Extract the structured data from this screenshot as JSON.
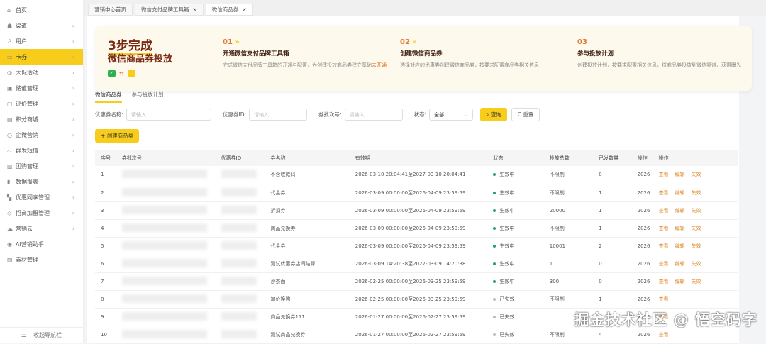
{
  "sidebar": {
    "items": [
      {
        "label": "首页",
        "icon": "⌂",
        "chev": false
      },
      {
        "label": "渠道",
        "icon": "☗",
        "chev": true
      },
      {
        "label": "用户",
        "icon": "♙",
        "chev": true
      },
      {
        "label": "卡券",
        "icon": "▭",
        "chev": true,
        "active": true
      },
      {
        "label": "大促活动",
        "icon": "◎",
        "chev": true
      },
      {
        "label": "储值管理",
        "icon": "▣",
        "chev": true
      },
      {
        "label": "评价管理",
        "icon": "▢",
        "chev": true
      },
      {
        "label": "积分商城",
        "icon": "▤",
        "chev": true
      },
      {
        "label": "企微营销",
        "icon": "○",
        "chev": true
      },
      {
        "label": "群发短信",
        "icon": "▱",
        "chev": true
      },
      {
        "label": "团购管理",
        "icon": "▥",
        "chev": true
      },
      {
        "label": "数据报表",
        "icon": "▮",
        "chev": true
      },
      {
        "label": "优惠同享管理",
        "icon": "▚",
        "chev": true
      },
      {
        "label": "招商加盟管理",
        "icon": "◇",
        "chev": true
      },
      {
        "label": "营销云",
        "icon": "☁",
        "chev": true
      },
      {
        "label": "AI营销助手",
        "icon": "◉",
        "chev": false
      },
      {
        "label": "素材管理",
        "icon": "▨",
        "chev": false
      }
    ],
    "collapse": "收起导航栏"
  },
  "tabs": [
    {
      "label": "营销中心首页",
      "close": false
    },
    {
      "label": "微信支付品牌工具箱",
      "close": true
    },
    {
      "label": "微信商品券",
      "close": true,
      "active": true
    }
  ],
  "banner": {
    "title1": "3步完成",
    "title2": "微信商品券投放",
    "meituan": "美团",
    "steps": [
      {
        "num": "01",
        "title": "开通微信支付品牌工具箱",
        "desc": "完成微信支付品牌工具箱的开通与配置，为创建投放商品券建立基础",
        "link": "去开通"
      },
      {
        "num": "02",
        "title": "创建微信商品券",
        "desc": "选择对应的优惠券创建微信商品券，按要求配置商品券相关信息",
        "link": ""
      },
      {
        "num": "03",
        "title": "参与投放计划",
        "desc": "创建投放计划，按要求配置相关信息，将商品券投放到微信渠道，获得曝光",
        "link": ""
      }
    ]
  },
  "subtabs": [
    "微信商品券",
    "参与投放计划"
  ],
  "filters": {
    "name_label": "优惠券名称:",
    "id_label": "优惠券ID:",
    "batch_label": "券批次号:",
    "placeholder": "请输入",
    "status_label": "状态:",
    "status_value": "全部",
    "search": "查询",
    "reset": "重置"
  },
  "create_button": "创建商品券",
  "table": {
    "headers": [
      "序号",
      "券批次号",
      "优惠券ID",
      "券名称",
      "有效期",
      "状态",
      "投放总数",
      "已发数量",
      "操作",
      "操作"
    ],
    "rows": [
      {
        "no": "1",
        "name": "不含收款码",
        "period": "2026-03-10 20:04:41至2027-03-10 20:04:41",
        "status": "生效中",
        "total": "不限制",
        "sent": "0",
        "op": "2026",
        "active": true
      },
      {
        "no": "2",
        "name": "代金券",
        "period": "2026-03-09 00:00:00至2026-04-09 23:59:59",
        "status": "生效中",
        "total": "不限制",
        "sent": "1",
        "op": "2026",
        "active": true
      },
      {
        "no": "3",
        "name": "折扣券",
        "period": "2026-03-09 00:00:00至2026-04-09 23:59:59",
        "status": "生效中",
        "total": "20000",
        "sent": "1",
        "op": "2026",
        "active": true
      },
      {
        "no": "4",
        "name": "商品兑换券",
        "period": "2026-03-09 00:00:00至2026-04-09 23:59:59",
        "status": "生效中",
        "total": "不限制",
        "sent": "1",
        "op": "2026",
        "active": true
      },
      {
        "no": "5",
        "name": "代金券",
        "period": "2026-03-09 00:00:00至2026-04-09 23:59:59",
        "status": "生效中",
        "total": "10001",
        "sent": "2",
        "op": "2026",
        "active": true
      },
      {
        "no": "6",
        "name": "测试优惠券店间结算",
        "period": "2026-03-09 14:20:38至2027-03-09 14:20:38",
        "status": "生效中",
        "total": "1",
        "sent": "0",
        "op": "2026",
        "active": true
      },
      {
        "no": "7",
        "name": "沙茶面",
        "period": "2026-02-25 00:00:00至2026-03-25 23:59:59",
        "status": "生效中",
        "total": "300",
        "sent": "0",
        "op": "2026",
        "active": true
      },
      {
        "no": "8",
        "name": "加价换购",
        "period": "2026-02-25 00:00:00至2026-03-25 23:59:59",
        "status": "已失效",
        "total": "不限制",
        "sent": "1",
        "op": "2026",
        "active": false
      },
      {
        "no": "9",
        "name": "商品兑换券111",
        "period": "2026-01-27 00:00:00至2026-02-27 23:59:59",
        "status": "已失效",
        "total": "",
        "sent": "",
        "op": "2026",
        "active": false
      },
      {
        "no": "10",
        "name": "测试商品兑换券",
        "period": "2026-01-27 00:00:00至2026-02-27 23:59:59",
        "status": "已失效",
        "total": "不限制",
        "sent": "4",
        "op": "2026",
        "active": false
      }
    ],
    "actions": {
      "view": "查看",
      "edit": "编辑",
      "disable": "失效"
    }
  },
  "watermark": "掘金技术社区 @ 悟空码字",
  "colors": {
    "accent": "#f7cc1b",
    "active_dot": "#2a9d6a",
    "inactive_dot": "#bbbbbb",
    "link": "#e0892a"
  }
}
